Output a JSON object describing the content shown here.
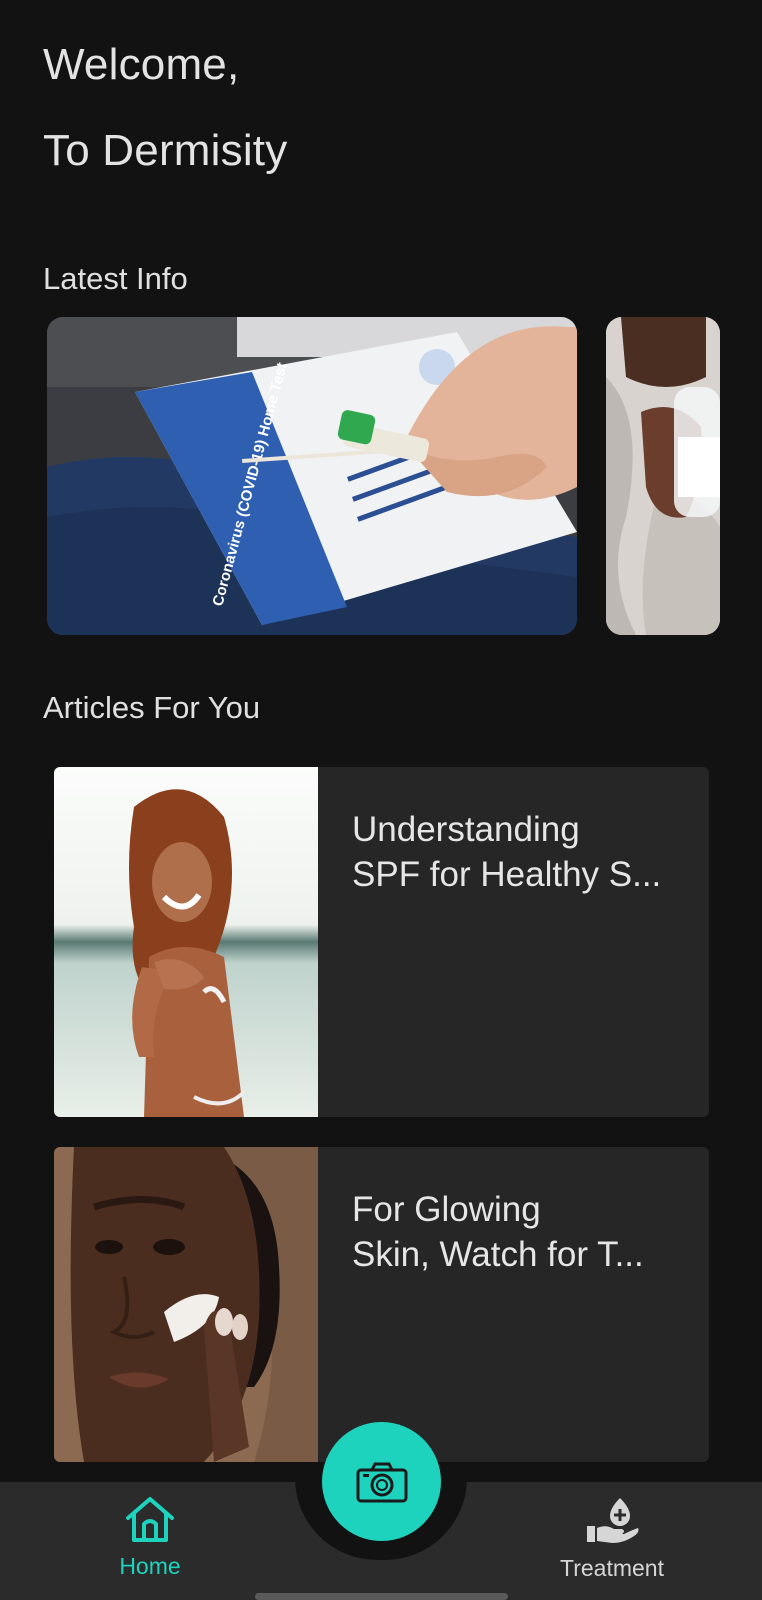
{
  "header": {
    "line1": "Welcome,",
    "line2": "To Dermisity"
  },
  "latest_info": {
    "title": "Latest Info",
    "cards": [
      {
        "image": "covid-home-test-kit-photo",
        "kit_text": "Coronavirus (COVID-19) Home Test"
      },
      {
        "image": "person-holding-water-glass-photo"
      }
    ]
  },
  "articles": {
    "title": "Articles For You",
    "items": [
      {
        "title": "Understanding\nSPF for Healthy S...",
        "image": "woman-applying-sunscreen-beach-photo"
      },
      {
        "title": " For Glowing\nSkin, Watch for T...",
        "image": "woman-face-cream-photo"
      }
    ]
  },
  "bottom_nav": {
    "home_label": "Home",
    "treatment_label": "Treatment",
    "fab_icon": "camera-icon"
  },
  "colors": {
    "accent": "#1ed3bd",
    "background": "#121212",
    "card": "#262626",
    "nav": "#2b2b2b"
  }
}
